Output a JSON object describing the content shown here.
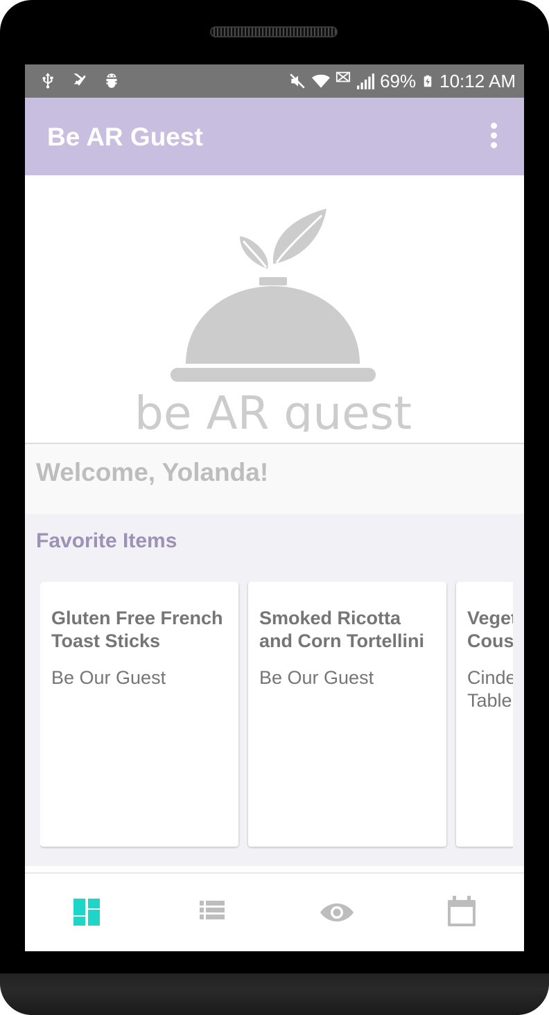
{
  "status_bar": {
    "left_icons": [
      "usb-icon",
      "check-download-icon",
      "android-debug-icon"
    ],
    "right_icons": [
      "mute-icon",
      "wifi-icon",
      "no-data-icon",
      "signal-icon",
      "battery-charging-icon"
    ],
    "battery": "69%",
    "time": "10:12 AM"
  },
  "app_bar": {
    "title": "Be AR Guest",
    "overflow_icon": "more-vert-icon"
  },
  "hero": {
    "logo_text": "be AR guest",
    "logo_icon": "serving-cloche-icon"
  },
  "welcome": {
    "text": "Welcome, Yolanda!"
  },
  "favorites": {
    "title": "Favorite Items",
    "items": [
      {
        "name": "Gluten Free French Toast Sticks",
        "restaurant": "Be Our Guest"
      },
      {
        "name": "Smoked Ricotta and Corn Tortellini",
        "restaurant": "Be Our Guest"
      },
      {
        "name": "Vegetable Couscous",
        "restaurant": "Cinderella's Royal Table"
      }
    ]
  },
  "bottom_nav": {
    "items": [
      {
        "icon": "dashboard-icon",
        "active": true
      },
      {
        "icon": "list-icon",
        "active": false
      },
      {
        "icon": "eye-icon",
        "active": false
      },
      {
        "icon": "calendar-icon",
        "active": false
      }
    ],
    "colors": {
      "active": "#1ed6c8",
      "inactive": "#bdbdbd"
    }
  },
  "colors": {
    "status_bar": "#757575",
    "app_bar": "#c8bedf",
    "accent_purple": "#9c92b5",
    "logo_gray": "#cccccc"
  }
}
